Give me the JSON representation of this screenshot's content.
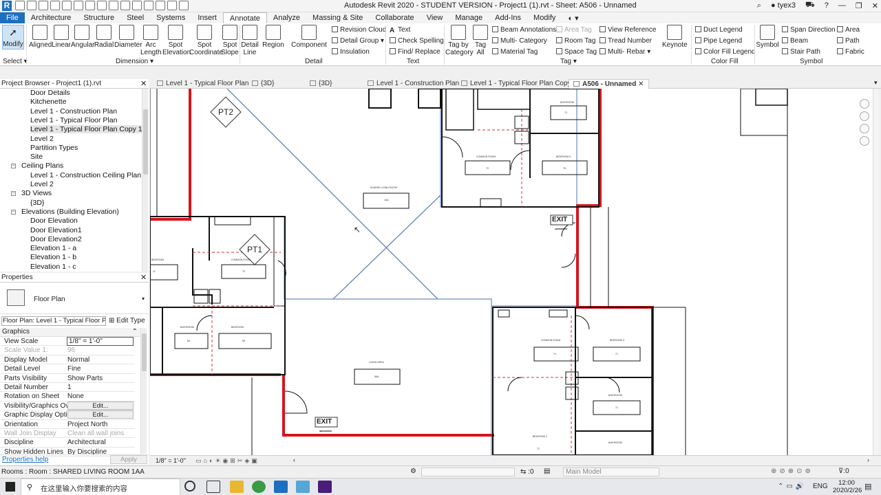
{
  "window": {
    "title": "Autodesk Revit 2020 - STUDENT VERSION - Project1 (1).rvt - Sheet: A506 - Unnamed",
    "user": "tyex3",
    "help": "?"
  },
  "ribbon_tabs": [
    "File",
    "Architecture",
    "Structure",
    "Steel",
    "Systems",
    "Insert",
    "Annotate",
    "Analyze",
    "Massing & Site",
    "Collaborate",
    "View",
    "Manage",
    "Add-Ins",
    "Modify"
  ],
  "active_tab": "Annotate",
  "ribbon": {
    "modify": "Modify",
    "dimension_tools": [
      "Aligned",
      "Linear",
      "Angular",
      "Radial",
      "Diameter"
    ],
    "arc_length": [
      "Arc",
      "Length"
    ],
    "spot_elevation": [
      "Spot",
      "Elevation"
    ],
    "spot_coordinate": [
      "Spot",
      "Coordinate"
    ],
    "spot_slope": [
      "Spot",
      "Slope"
    ],
    "detail_line": [
      "Detail",
      "Line"
    ],
    "region": "Region",
    "component": "Component",
    "revision_cloud": "Revision  Cloud",
    "detail_group": "Detail  Group",
    "insulation": "Insulation",
    "text": "Text",
    "check_spelling": "Check  Spelling",
    "find_replace": "Find/  Replace",
    "tag_by_category": [
      "Tag by",
      "Category"
    ],
    "tag_all": [
      "Tag",
      "All"
    ],
    "beam_annotations": "Beam  Annotations",
    "multi_category": "Multi- Category",
    "material_tag": "Material  Tag",
    "area_tag": "Area  Tag",
    "room_tag": "Room  Tag",
    "space_tag": "Space  Tag",
    "view_reference": "View  Reference",
    "tread_number": "Tread  Number",
    "multi_rebar": "Multi- Rebar",
    "keynote": "Keynote",
    "duct_legend": "Duct  Legend",
    "pipe_legend": "Pipe  Legend",
    "color_fill_legend": "Color Fill  Legend",
    "symbol": "Symbol",
    "span_direction": "Span  Direction",
    "beam": "Beam",
    "stair_path": "Stair  Path",
    "area": "Area",
    "path": "Path",
    "fabric": "Fabric",
    "panels": [
      "Select",
      "Dimension",
      "Detail",
      "Text",
      "Tag",
      "Color Fill",
      "Symbol"
    ]
  },
  "project_browser": {
    "title": "Project Browser - Project1 (1).rvt",
    "items": [
      {
        "label": "Door Details",
        "level": 2
      },
      {
        "label": "Kitchenette",
        "level": 2
      },
      {
        "label": "Level 1 - Construction Plan",
        "level": 2
      },
      {
        "label": "Level 1 - Typical Floor Plan",
        "level": 2
      },
      {
        "label": "Level 1 - Typical Floor Plan Copy 1",
        "level": 2,
        "selected": true
      },
      {
        "label": "Level 2",
        "level": 2
      },
      {
        "label": "Partition Types",
        "level": 2
      },
      {
        "label": "Site",
        "level": 2
      },
      {
        "label": "Ceiling Plans",
        "level": 1,
        "toggle": "−"
      },
      {
        "label": "Level 1 - Construction Ceiling Plan",
        "level": 2
      },
      {
        "label": "Level 2",
        "level": 2
      },
      {
        "label": "3D Views",
        "level": 1,
        "toggle": "−"
      },
      {
        "label": "{3D}",
        "level": 2
      },
      {
        "label": "Elevations (Building Elevation)",
        "level": 1,
        "toggle": "−"
      },
      {
        "label": "Door Elevation",
        "level": 2
      },
      {
        "label": "Door Elevation1",
        "level": 2
      },
      {
        "label": "Door Elevation2",
        "level": 2
      },
      {
        "label": "Elevation 1 - a",
        "level": 2
      },
      {
        "label": "Elevation 1 - b",
        "level": 2
      },
      {
        "label": "Elevation 1 - c",
        "level": 2
      }
    ]
  },
  "properties": {
    "title": "Properties",
    "type": "Floor Plan",
    "selector": "Floor Plan: Level 1 - Typical Floor Pl",
    "edit_type": "Edit Type",
    "section": "Graphics",
    "rows": [
      {
        "k": "View Scale",
        "v": "1/8\" = 1'-0\"",
        "box": true
      },
      {
        "k": "Scale Value    1:",
        "v": "96",
        "dim": true
      },
      {
        "k": "Display Model",
        "v": "Normal"
      },
      {
        "k": "Detail Level",
        "v": "Fine"
      },
      {
        "k": "Parts Visibility",
        "v": "Show Parts"
      },
      {
        "k": "Detail Number",
        "v": "1"
      },
      {
        "k": "Rotation on Sheet",
        "v": "None"
      },
      {
        "k": "Visibility/Graphics Ov...",
        "v": "Edit...",
        "btn": true
      },
      {
        "k": "Graphic Display Opti...",
        "v": "Edit...",
        "btn": true
      },
      {
        "k": "Orientation",
        "v": "Project North"
      },
      {
        "k": "Wall Join Display",
        "v": "Clean all wall joins",
        "dim": true
      },
      {
        "k": "Discipline",
        "v": "Architectural"
      },
      {
        "k": "Show Hidden Lines",
        "v": "By Discipline"
      }
    ],
    "help": "Properties help",
    "apply": "Apply"
  },
  "view_tabs": [
    {
      "label": "Level 1 - Typical Floor Plan"
    },
    {
      "label": "{3D}"
    },
    {
      "label": "{3D}"
    },
    {
      "label": "Level 1 - Construction Plan"
    },
    {
      "label": "Level 1 - Typical Floor Plan Copy..."
    },
    {
      "label": "A506 - Unnamed",
      "active": true
    }
  ],
  "canvas": {
    "tags": [
      "PT2",
      "PT1"
    ],
    "exit_labels": [
      "EXIT",
      "EXIT"
    ],
    "room_names": [
      "SHARED LIVING ROOM",
      "COMMON ROOM",
      "BEDROOM 5",
      "BATHROOM",
      "BATHROOM",
      "BEDROOM",
      "COMMON ROOM",
      "LIVING AREA",
      "COMMON ROOM",
      "BEDROOM 3",
      "BATHROOM",
      "BEDROOM 2",
      "BATHROOM",
      "BEDROOM"
    ],
    "room_numbers": [
      "1AA",
      "72",
      "76",
      "73",
      "66",
      "55",
      "70",
      "56A",
      "74",
      "71",
      "71",
      "72",
      "47",
      "75"
    ]
  },
  "view_control": {
    "scale": "1/8\" = 1'-0\""
  },
  "status": {
    "text": "Rooms : Room : SHARED LIVING ROOM 1AA",
    "zero": ":0",
    "model": "Main Model",
    "filter": ":0"
  },
  "taskbar": {
    "search_placeholder": "在这里输入你要搜索的内容",
    "time": "12:00",
    "date": "2020/2/26",
    "lang": "ENG"
  },
  "colors": {
    "accent": "#1d6fbf",
    "wall_red": "#d8141b",
    "plan_blue": "#5b7bb0"
  }
}
